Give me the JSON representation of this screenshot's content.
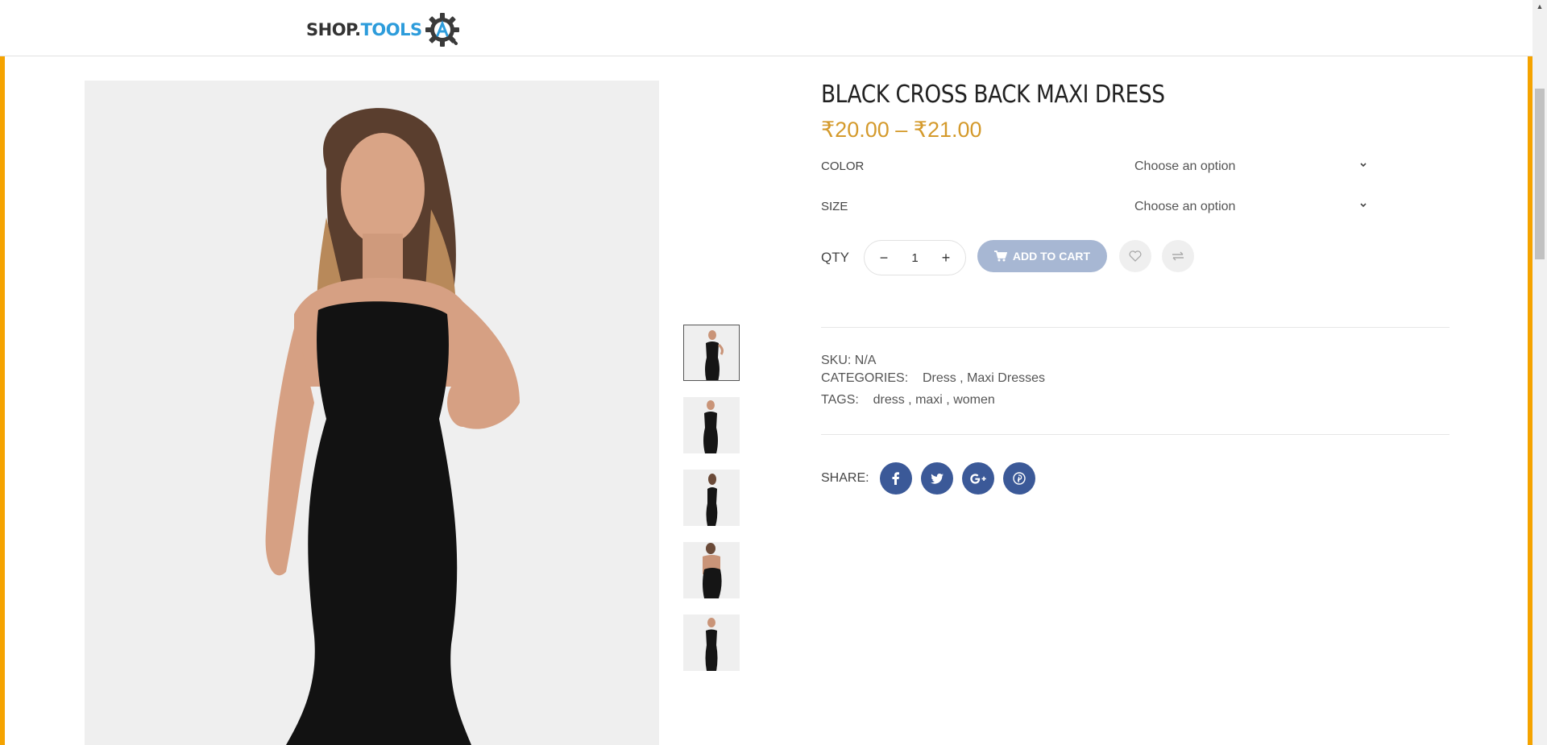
{
  "header": {
    "logo_part1": "SHOP.",
    "logo_part2": "TOOLS"
  },
  "product": {
    "title": "BLACK CROSS BACK MAXI DRESS",
    "price_range": "₹20.00 – ₹21.00",
    "variations": [
      {
        "label": "COLOR",
        "placeholder": "Choose an option"
      },
      {
        "label": "SIZE",
        "placeholder": "Choose an option"
      }
    ],
    "qty_label": "QTY",
    "qty_value": "1",
    "add_to_cart_label": "ADD TO CART",
    "sku_label": "SKU:",
    "sku_value": "N/A",
    "categories_label": "CATEGORIES:",
    "categories": [
      "Dress",
      "Maxi Dresses"
    ],
    "tags_label": "TAGS:",
    "tags": [
      "dress",
      "maxi",
      "women"
    ],
    "share_label": "SHARE:",
    "share_icons": [
      "facebook-icon",
      "twitter-icon",
      "google-plus-icon",
      "pinterest-icon"
    ],
    "thumbnail_count": 5
  },
  "colors": {
    "accent_border": "#f5a300",
    "price": "#d49a2c",
    "add_to_cart_bg": "#a7b7d3",
    "social_bg": "#3b5998",
    "logo_tools": "#2d9cdb"
  }
}
